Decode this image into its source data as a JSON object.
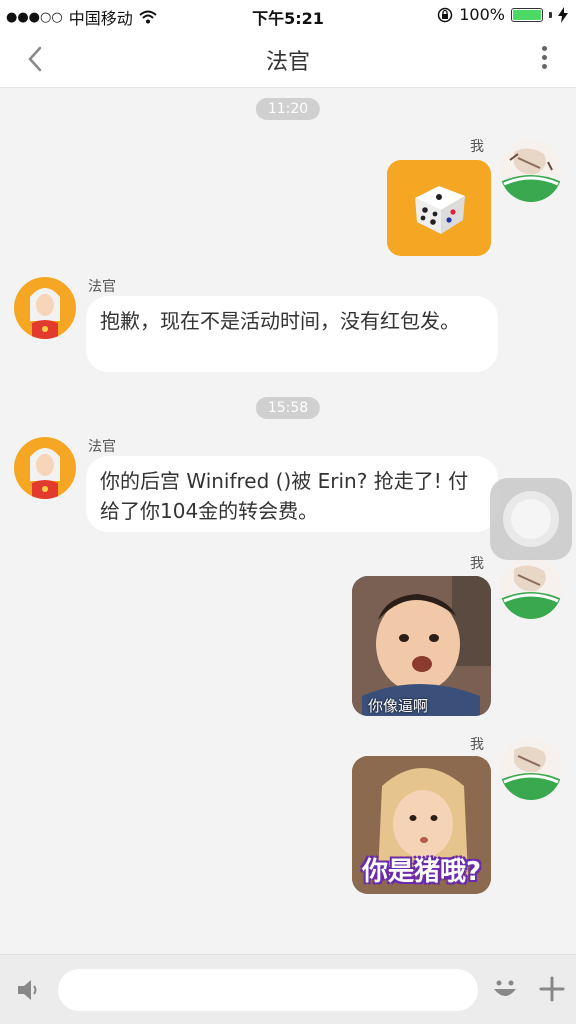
{
  "status_bar": {
    "signal": "●●●○○",
    "carrier": "中国移动",
    "time": "下午5:21",
    "battery": "100%",
    "battery_color": "#4cd964"
  },
  "header": {
    "title": "法官",
    "back_icon": "chevron-left-icon",
    "more_icon": "more-vertical-icon"
  },
  "chat": {
    "time_stamps": [
      "11:20",
      "15:58"
    ],
    "messages": [
      {
        "sender": "我",
        "type": "image",
        "image": "dice-icon",
        "bg": "#f5a623"
      },
      {
        "sender": "法官",
        "type": "text",
        "text": "抱歉，现在不是活动时间，没有红包发。"
      },
      {
        "sender": "法官",
        "type": "text",
        "text": "你的后宫 Winifred ()被 Erin? 抢走了! 付给了你104金的转会费。"
      },
      {
        "sender": "我",
        "type": "sticker",
        "caption": "你像逼啊"
      },
      {
        "sender": "我",
        "type": "sticker",
        "caption": "你是猪哦?"
      }
    ]
  },
  "input_bar": {
    "placeholder": "",
    "voice_icon": "voice-icon",
    "emoji_icon": "emoji-icon",
    "plus_icon": "plus-icon"
  },
  "colors": {
    "accent": "#f5a623",
    "bubble": "#ffffff",
    "background": "#f3f3f3"
  }
}
